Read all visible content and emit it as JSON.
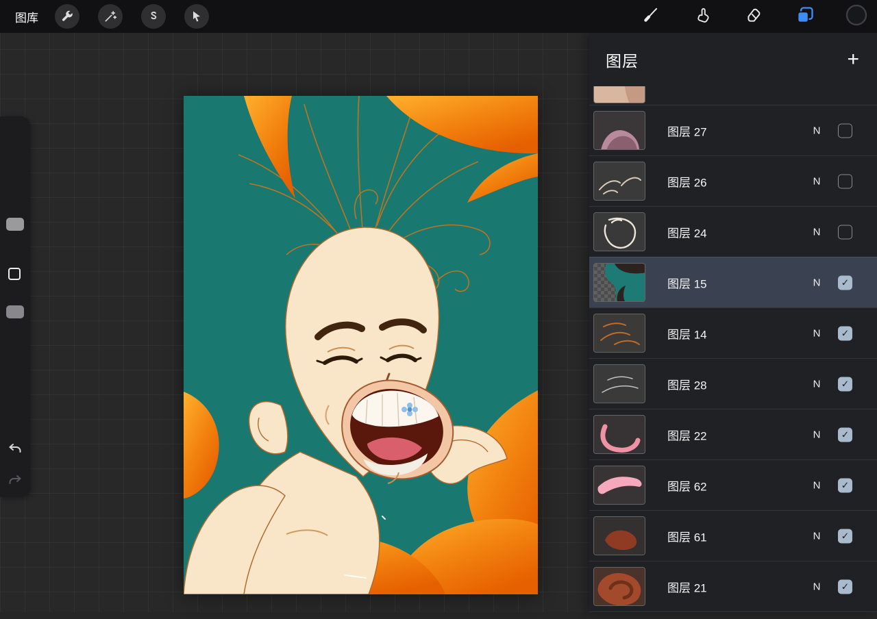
{
  "topbar": {
    "gallery_label": "图库",
    "left_tools": [
      "wrench-icon",
      "magic-wand-icon",
      "selection-ribbon-icon",
      "transform-cursor-icon"
    ],
    "right_tools": [
      "brush-icon",
      "smudge-icon",
      "eraser-icon",
      "layers-icon",
      "color-circle-icon"
    ],
    "active_tool": "layers"
  },
  "side_toolbar": {
    "controls": [
      "brush-size-slider",
      "modify-button",
      "opacity-slider",
      "undo-icon",
      "redo-icon"
    ]
  },
  "layers_panel": {
    "title": "图层",
    "add_label": "+",
    "rows": [
      {
        "name": "图层 27",
        "blend": "N",
        "visible": false,
        "selected": false
      },
      {
        "name": "图层 26",
        "blend": "N",
        "visible": false,
        "selected": false
      },
      {
        "name": "图层 24",
        "blend": "N",
        "visible": false,
        "selected": false
      },
      {
        "name": "图层 15",
        "blend": "N",
        "visible": true,
        "selected": true
      },
      {
        "name": "图层 14",
        "blend": "N",
        "visible": true,
        "selected": false
      },
      {
        "name": "图层 28",
        "blend": "N",
        "visible": true,
        "selected": false
      },
      {
        "name": "图层 22",
        "blend": "N",
        "visible": true,
        "selected": false
      },
      {
        "name": "图层 62",
        "blend": "N",
        "visible": true,
        "selected": false
      },
      {
        "name": "图层 61",
        "blend": "N",
        "visible": true,
        "selected": false
      },
      {
        "name": "图层 21",
        "blend": "N",
        "visible": true,
        "selected": false
      }
    ]
  },
  "colors": {
    "accent_blue": "#3f8cf7",
    "canvas_teal": "#19786f",
    "hair_orange": "#f2820e",
    "panel_bg": "#202124",
    "topbar_bg": "#111113"
  }
}
